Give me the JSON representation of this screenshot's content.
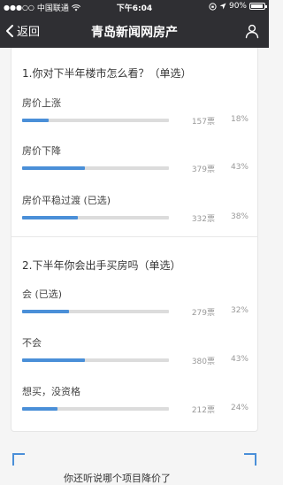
{
  "status_bar": {
    "carrier": "中国联通",
    "time": "下午6:04",
    "battery": "90%",
    "battery_level": 0.9
  },
  "nav": {
    "back_label": "返回",
    "title": "青岛新闻网房产"
  },
  "questions": [
    {
      "title": "1.你对下半年楼市怎么看？（单选）",
      "options": [
        {
          "label": "房价上涨",
          "votes": "157票",
          "percent": "18%",
          "fraction": 0.18
        },
        {
          "label": "房价下降",
          "votes": "379票",
          "percent": "43%",
          "fraction": 0.43
        },
        {
          "label": "房价平稳过渡 (已选)",
          "votes": "332票",
          "percent": "38%",
          "fraction": 0.38
        }
      ]
    },
    {
      "title": "2.下半年你会出手买房吗（单选）",
      "options": [
        {
          "label": "会 (已选)",
          "votes": "279票",
          "percent": "32%",
          "fraction": 0.32
        },
        {
          "label": "不会",
          "votes": "380票",
          "percent": "43%",
          "fraction": 0.43
        },
        {
          "label": "想买，没资格",
          "votes": "212票",
          "percent": "24%",
          "fraction": 0.24
        }
      ]
    }
  ],
  "bottom": {
    "text": "你还听说哪个项目降价了"
  },
  "colors": {
    "nav_bg": "#2f2f33",
    "accent": "#4a8fd8",
    "track": "#dcdcdc"
  }
}
